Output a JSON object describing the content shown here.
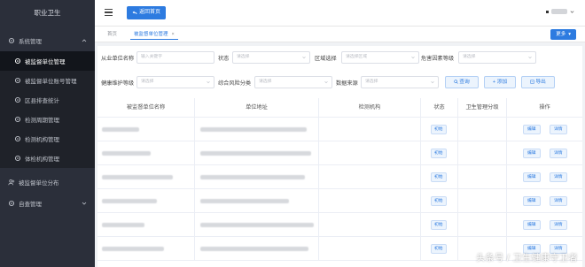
{
  "sidebar": {
    "title": "职业卫生",
    "items": [
      {
        "label": "系统管理",
        "icon": "gear-icon"
      },
      {
        "label": "被监督单位管理",
        "icon": "gear-icon"
      },
      {
        "label": "被监督单位账号管理",
        "icon": "gear-icon"
      },
      {
        "label": "区县排查统计",
        "icon": "gear-icon"
      },
      {
        "label": "检测周期管理",
        "icon": "gear-icon"
      },
      {
        "label": "检测机构管理",
        "icon": "gear-icon"
      },
      {
        "label": "体检机构管理",
        "icon": "gear-icon"
      },
      {
        "label": "被监督单位分布",
        "icon": "users-icon"
      },
      {
        "label": "自查管理",
        "icon": "gear-icon"
      }
    ]
  },
  "header": {
    "back_label": "返回首页"
  },
  "tabs": {
    "home": "首页",
    "active": "被监督单位管理",
    "close": "×",
    "more_label": "更多"
  },
  "filters": {
    "company_label": "从业单位名称",
    "company_placeholder": "输入关键字",
    "status_label": "状态",
    "status_placeholder": "请选择",
    "region_label": "区域选择",
    "region_placeholder": "请选择区域",
    "hazard_label": "危害因素等级",
    "hazard_placeholder": "请选择",
    "health_label": "健康维护等级",
    "health_placeholder": "请选择",
    "risk_label": "综合风险分类",
    "risk_placeholder": "请选择",
    "source_label": "数据来源",
    "source_placeholder": "请选择",
    "query_label": "查询",
    "add_label": "添加",
    "export_label": "导出"
  },
  "table": {
    "columns": [
      "被监督单位名称",
      "单位地址",
      "检测机构",
      "状态",
      "卫生管理分级",
      "操作"
    ],
    "rows": [
      {
        "status": "初始",
        "edit": "编辑",
        "detail": "详情"
      },
      {
        "status": "初始",
        "edit": "编辑",
        "detail": "详情"
      },
      {
        "status": "初始",
        "edit": "编辑",
        "detail": "详情"
      },
      {
        "status": "初始",
        "edit": "编辑",
        "detail": "详情"
      },
      {
        "status": "初始",
        "edit": "编辑",
        "detail": "详情"
      },
      {
        "status": "初始",
        "edit": "编辑",
        "detail": "详情"
      }
    ]
  },
  "watermark": "头条号 / 卫生健康守卫者",
  "colors": {
    "sidebar": "#2b2f3a",
    "accent": "#2d7be0"
  }
}
